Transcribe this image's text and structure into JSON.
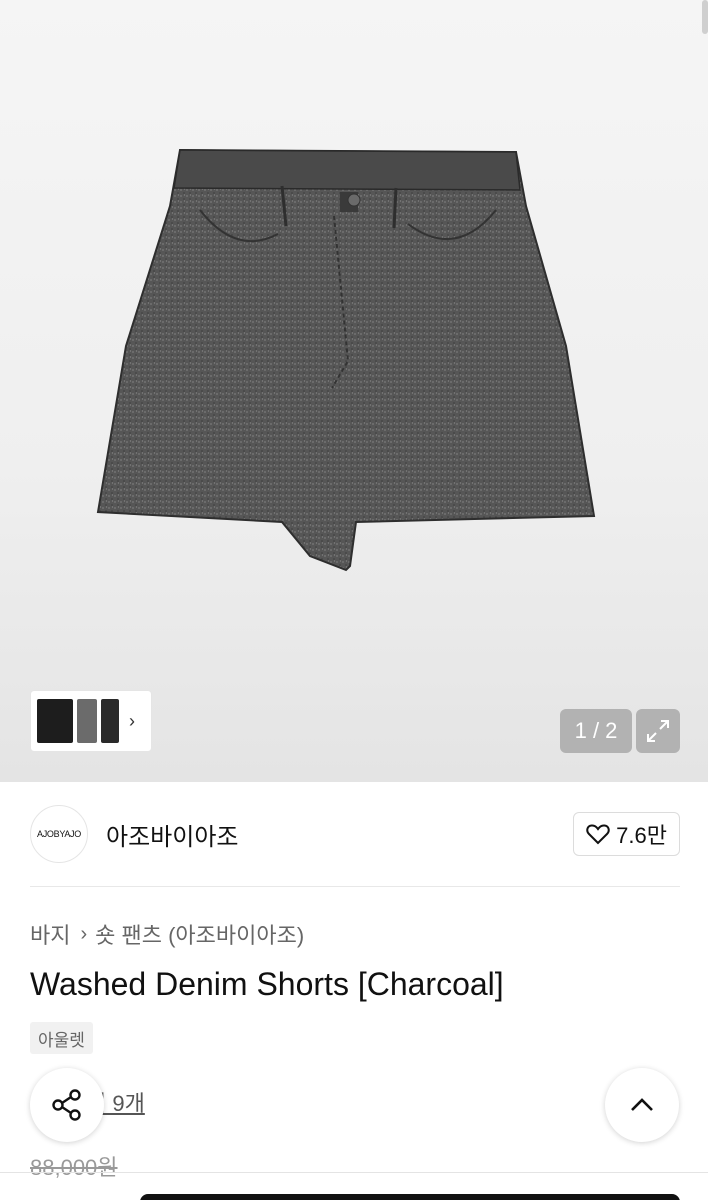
{
  "gallery": {
    "counter": "1 / 2",
    "thumbnail_count": 3
  },
  "brand": {
    "logo_text": "AJOBYAJO",
    "name": "아조바이아조",
    "likes": "7.6만"
  },
  "breadcrumb": {
    "category": "바지",
    "subcategory": "숏 팬츠 (아조바이아조)"
  },
  "product": {
    "title": "Washed Denim Shorts [Charcoal]",
    "badge": "아울렛",
    "review_text": "기 9개",
    "original_price": "88,000원"
  },
  "colors": {
    "accent": "#111111",
    "muted_text": "#666666"
  },
  "icons": [
    "heart-icon",
    "expand-icon",
    "chevron-right-icon",
    "share-icon",
    "chevron-up-icon"
  ]
}
